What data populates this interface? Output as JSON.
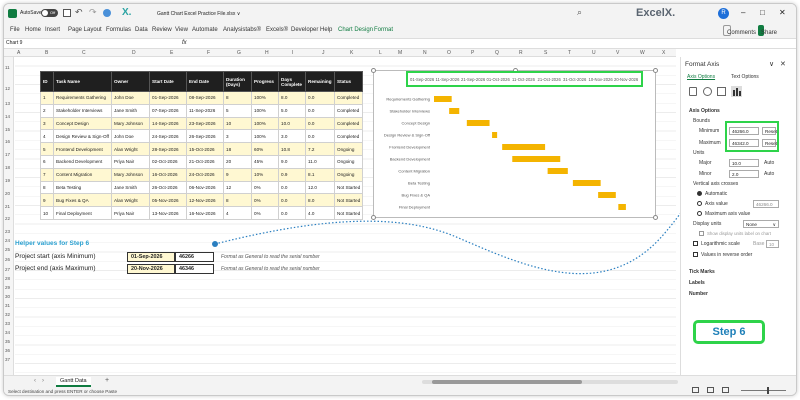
{
  "titlebar": {
    "autosave_label": "AutoSave",
    "autosave_state": "Off",
    "file_title": "Gantt Chart Excel Practice File.xlsx ∨",
    "brand": "ExcelX.",
    "avatar": "R",
    "minimize": "–",
    "restore": "□",
    "close": "✕"
  },
  "menu": {
    "items": [
      "File",
      "Home",
      "Insert",
      "Page Layout",
      "Formulas",
      "Data",
      "Review",
      "View",
      "Automate",
      "Analysistabs®",
      "Excels®",
      "Developer",
      "Help",
      "Chart Design",
      "Format"
    ],
    "comments": "Comments",
    "share": "Share"
  },
  "formula_bar": {
    "name_box": "Chart 9",
    "fx": "fx"
  },
  "columns": [
    "A",
    "B",
    "C",
    "D",
    "E",
    "F",
    "G",
    "H",
    "I",
    "J",
    "K",
    "L",
    "M",
    "N",
    "O",
    "P",
    "Q",
    "R",
    "S",
    "T",
    "U",
    "V",
    "W",
    "X"
  ],
  "rows": [
    "11",
    "12",
    "13",
    "14",
    "15",
    "16",
    "17",
    "18",
    "19",
    "20",
    "21",
    "22",
    "23",
    "24",
    "25",
    "26",
    "27",
    "28",
    "29",
    "30",
    "31",
    "32",
    "33",
    "34",
    "35",
    "36",
    "37",
    "38",
    "39",
    "40",
    "41"
  ],
  "table": {
    "headers": [
      "ID",
      "Task Name",
      "Owner",
      "Start Date",
      "End Date",
      "Duration (Days)",
      "Progress",
      "Days Complete",
      "Remaining",
      "Status"
    ],
    "rows": [
      [
        "1",
        "Requirements Gathering",
        "John Doe",
        "01-Sep-2026",
        "08-Sep-2026",
        "8",
        "100%",
        "8.0",
        "0.0",
        "Completed"
      ],
      [
        "2",
        "Stakeholder Interviews",
        "Jane Smith",
        "07-Sep-2026",
        "11-Sep-2026",
        "5",
        "100%",
        "5.0",
        "0.0",
        "Completed"
      ],
      [
        "3",
        "Concept Design",
        "Mary Johnson",
        "14-Sep-2026",
        "23-Sep-2026",
        "10",
        "100%",
        "10.0",
        "0.0",
        "Completed"
      ],
      [
        "4",
        "Design Review & Sign-Off",
        "John Doe",
        "24-Sep-2026",
        "26-Sep-2026",
        "3",
        "100%",
        "3.0",
        "0.0",
        "Completed"
      ],
      [
        "5",
        "Frontend Development",
        "Alan Wright",
        "28-Sep-2026",
        "15-Oct-2026",
        "18",
        "60%",
        "10.8",
        "7.2",
        "Ongoing"
      ],
      [
        "6",
        "Backend Development",
        "Priya Nair",
        "02-Oct-2026",
        "21-Oct-2026",
        "20",
        "45%",
        "9.0",
        "11.0",
        "Ongoing"
      ],
      [
        "7",
        "Content Migration",
        "Mary Johnson",
        "16-Oct-2026",
        "24-Oct-2026",
        "9",
        "10%",
        "0.9",
        "8.1",
        "Ongoing"
      ],
      [
        "8",
        "Beta Testing",
        "Jane Smith",
        "26-Oct-2026",
        "06-Nov-2026",
        "12",
        "0%",
        "0.0",
        "12.0",
        "Not Started"
      ],
      [
        "9",
        "Bug Fixes & QA",
        "Alan Wright",
        "05-Nov-2026",
        "12-Nov-2026",
        "8",
        "0%",
        "0.0",
        "8.0",
        "Not Started"
      ],
      [
        "10",
        "Final Deployment",
        "Priya Nair",
        "13-Nov-2026",
        "16-Nov-2026",
        "4",
        "0%",
        "0.0",
        "4.0",
        "Not Started"
      ]
    ]
  },
  "helper": {
    "title": "Helper values for Step 6",
    "start_label": "Project start (axis Minimum)",
    "start_date": "01-Sep-2026",
    "start_serial": "46266",
    "end_label": "Project end (axis Maximum)",
    "end_date": "20-Nov-2026",
    "end_serial": "46346",
    "note1": "Format as General to read the serial number",
    "note2": "Format as General to read the serial number"
  },
  "chart_data": {
    "type": "bar",
    "axis_labels": [
      "01-Sep-2026",
      "11-Sep-2026",
      "21-Sep-2026",
      "01-Oct-2026",
      "11-Oct-2026",
      "21-Oct-2026",
      "31-Oct-2026",
      "10-Nov-2026",
      "20-Nov-2026"
    ],
    "tasks": [
      "Requirements Gathering",
      "Stakeholder Interviews",
      "Concept Design",
      "Design Review & Sign-Off",
      "Frontend Development",
      "Backend Development",
      "Content Migration",
      "Beta Testing",
      "Bug Fixes & QA",
      "Final Deployment"
    ],
    "start": [
      "2026-09-01",
      "2026-09-07",
      "2026-09-14",
      "2026-09-24",
      "2026-09-28",
      "2026-10-02",
      "2026-10-16",
      "2026-10-26",
      "2026-11-05",
      "2026-11-13"
    ],
    "end": [
      "2026-09-08",
      "2026-09-11",
      "2026-09-23",
      "2026-09-26",
      "2026-10-15",
      "2026-10-21",
      "2026-10-24",
      "2026-11-06",
      "2026-11-12",
      "2026-11-16"
    ],
    "axis_min": "2026-09-01",
    "axis_max": "2026-11-20",
    "bar_color": "#f4b400"
  },
  "panel": {
    "title": "Format Axis",
    "tab1": "Axis Options",
    "tab2": "Text Options",
    "section": "Axis Options",
    "bounds": "Bounds",
    "minimum_label": "Minimum",
    "minimum_value": "46266.0",
    "maximum_label": "Maximum",
    "maximum_value": "46342.0",
    "reset": "Reset",
    "units": "Units",
    "major_label": "Major",
    "major_value": "10.0",
    "minor_label": "Minor",
    "minor_value": "2.0",
    "auto": "Auto",
    "vertical_crosses": "Vertical axis crosses",
    "automatic": "Automatic",
    "axis_value": "Axis value",
    "axis_value_box": "46266.0",
    "max_axis_value": "Maximum axis value",
    "display_units": "Display units",
    "display_units_value": "None",
    "show_label": "Show display units label on chart",
    "log_scale": "Logarithmic scale",
    "base_label": "Base",
    "base_value": "10",
    "reverse": "Values in reverse order",
    "tick_marks": "Tick Marks",
    "labels": "Labels",
    "number": "Number"
  },
  "step_badge": "Step 6",
  "sheet_tab": "Gantt Data",
  "status_text": "Select destination and press ENTER or choose Paste"
}
